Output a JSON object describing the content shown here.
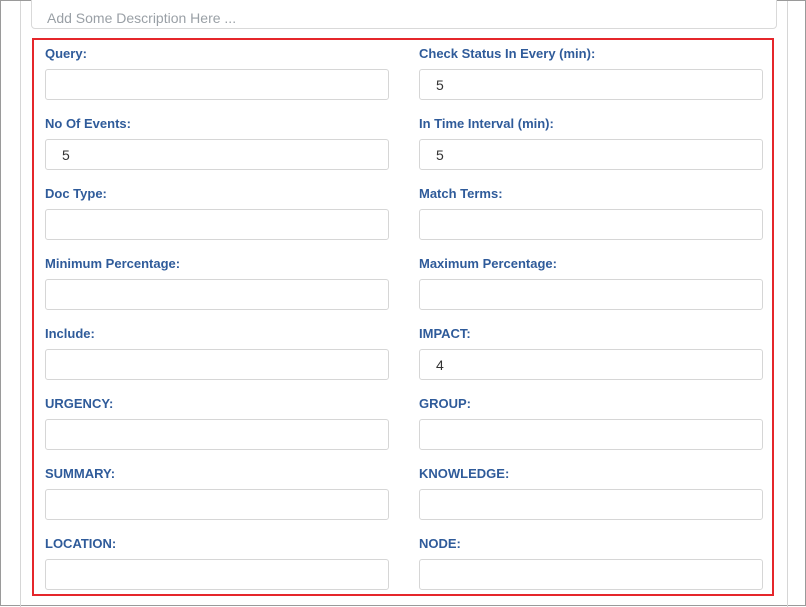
{
  "description": {
    "placeholder": "Add Some Description Here ..."
  },
  "fields": [
    {
      "label": "Query:",
      "value": ""
    },
    {
      "label": "Check Status In Every (min):",
      "value": "5"
    },
    {
      "label": "No Of Events:",
      "value": "5"
    },
    {
      "label": "In Time Interval (min):",
      "value": "5"
    },
    {
      "label": "Doc Type:",
      "value": ""
    },
    {
      "label": "Match Terms:",
      "value": ""
    },
    {
      "label": "Minimum Percentage:",
      "value": ""
    },
    {
      "label": "Maximum Percentage:",
      "value": ""
    },
    {
      "label": "Include:",
      "value": ""
    },
    {
      "label": "IMPACT:",
      "value": "4"
    },
    {
      "label": "URGENCY:",
      "value": ""
    },
    {
      "label": "GROUP:",
      "value": ""
    },
    {
      "label": "SUMMARY:",
      "value": ""
    },
    {
      "label": "KNOWLEDGE:",
      "value": ""
    },
    {
      "label": "LOCATION:",
      "value": ""
    },
    {
      "label": "NODE:",
      "value": ""
    }
  ],
  "colors": {
    "label": "#2f5b9a",
    "highlight_border": "#e5262b",
    "input_border": "#d6d6d6"
  }
}
